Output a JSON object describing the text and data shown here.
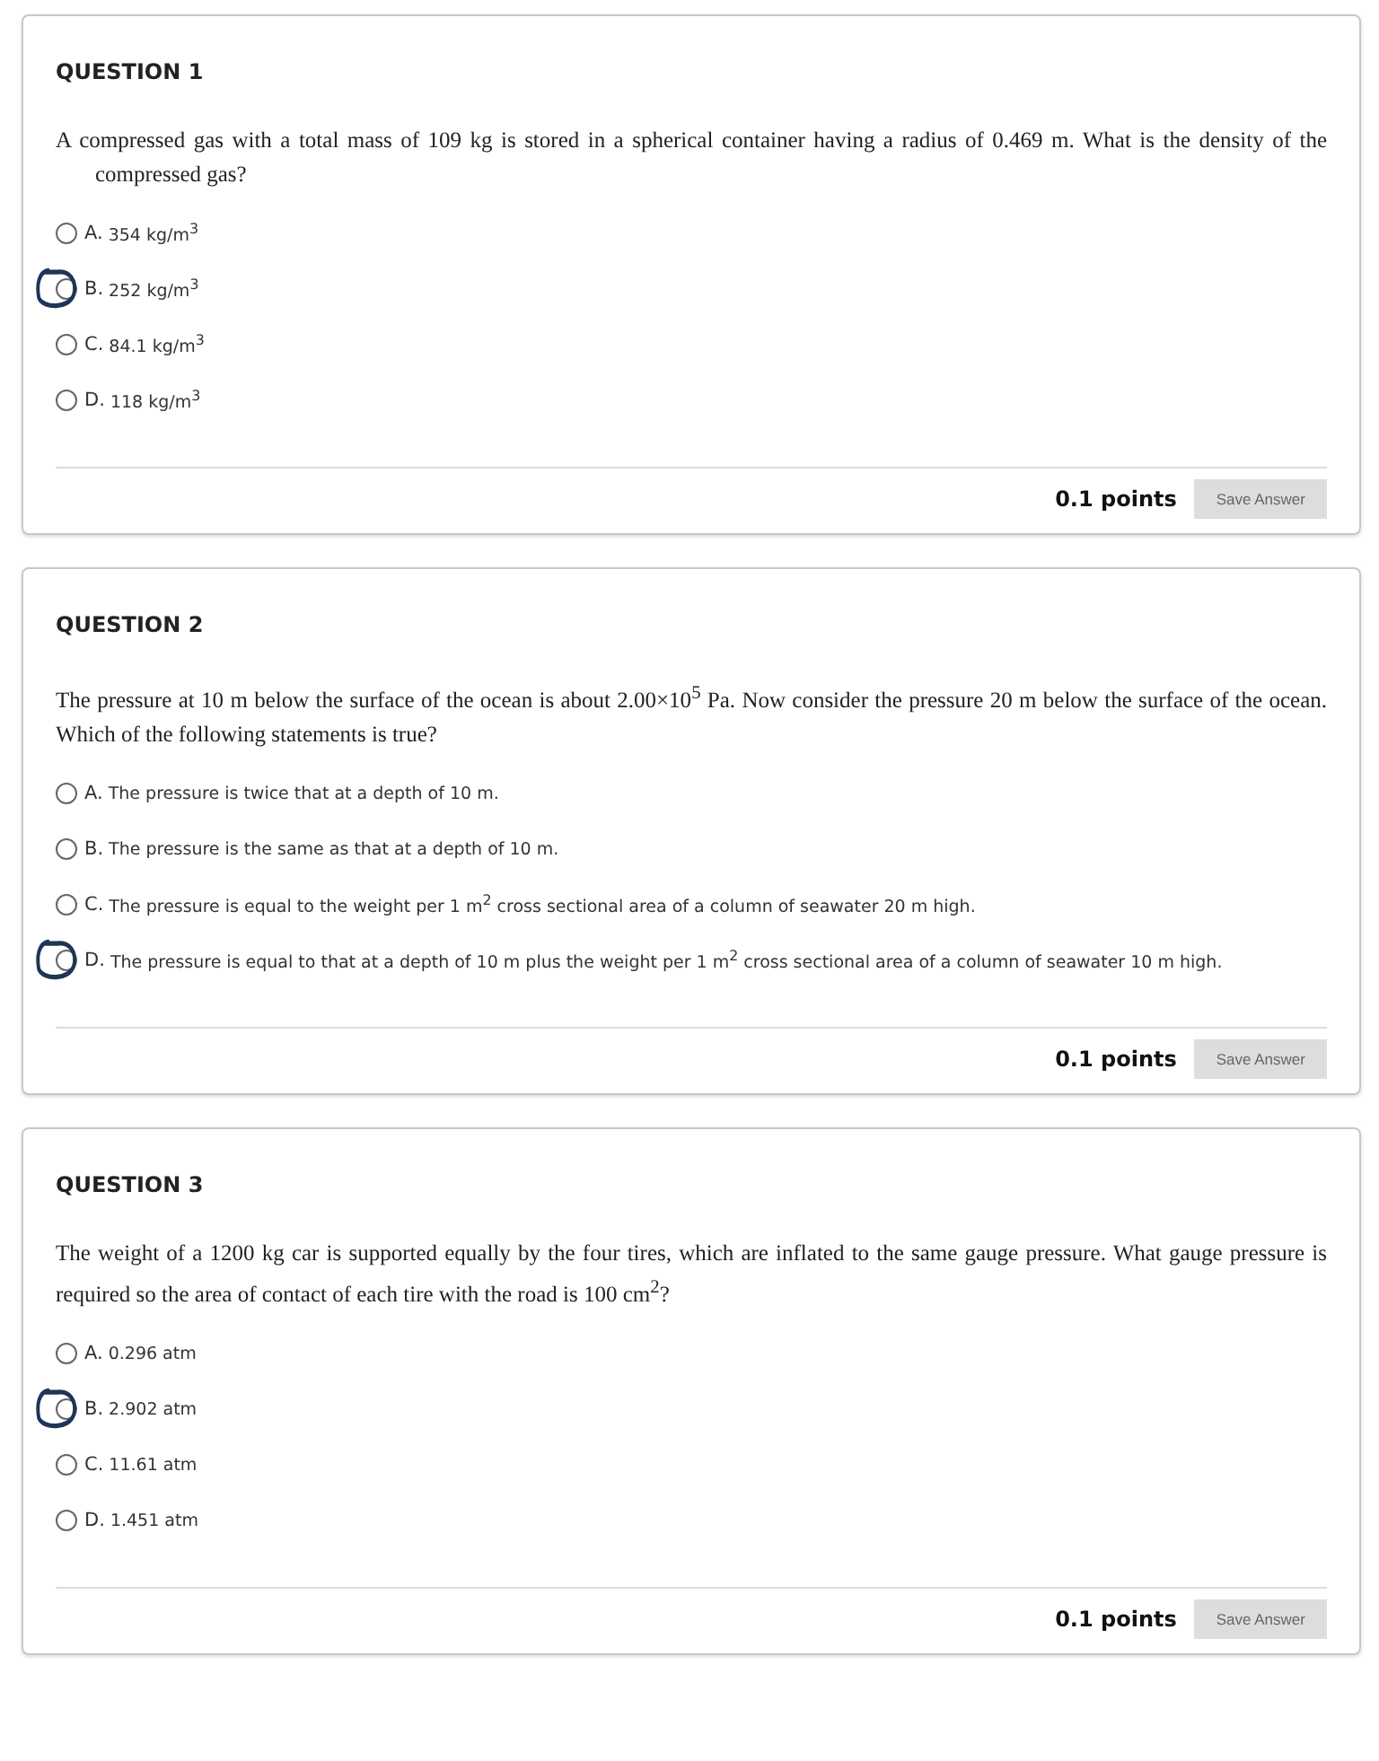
{
  "questions": [
    {
      "title": "QUESTION 1",
      "text": "A compressed gas with a total mass of 109 kg is stored in a spherical container having a radius of 0.469 m. What is the density of the compressed gas?",
      "hanging": true,
      "options": [
        {
          "letter": "A.",
          "text": "354 kg/m$^{3}$",
          "selected": false,
          "marked": false
        },
        {
          "letter": "B.",
          "text": "252 kg/m$^{3}$",
          "selected": false,
          "marked": true
        },
        {
          "letter": "C.",
          "text": "84.1 kg/m$^{3}$",
          "selected": false,
          "marked": false
        },
        {
          "letter": "D.",
          "text": "118 kg/m$^{3}$",
          "selected": false,
          "marked": false
        }
      ],
      "points": "0.1 points",
      "button": "Save Answer"
    },
    {
      "title": "QUESTION 2",
      "text": "The pressure at 10 m below the surface of the ocean is about 2.00×10$^{5}$ Pa. Now consider the pressure 20 m below the surface of the ocean. Which of the following statements is true?",
      "hanging": false,
      "options": [
        {
          "letter": "A.",
          "text": "The pressure is twice that at a depth of 10 m.",
          "selected": false,
          "marked": false
        },
        {
          "letter": "B.",
          "text": "The pressure is the same as that at a depth of 10 m.",
          "selected": false,
          "marked": false
        },
        {
          "letter": "C.",
          "text": "The pressure is equal to the weight per 1 m$^{2}$ cross sectional area of a column of seawater 20 m high.",
          "selected": false,
          "marked": false
        },
        {
          "letter": "D.",
          "text": "The pressure is equal to that at a depth of 10 m plus the weight per 1 m$^{2}$ cross sectional area of a column of seawater 10 m high.",
          "selected": false,
          "marked": true
        }
      ],
      "points": "0.1 points",
      "button": "Save Answer"
    },
    {
      "title": "QUESTION 3",
      "text": "The weight of a 1200 kg car is supported equally by the four tires, which are inflated to the same gauge pressure. What gauge pressure is required so the area of contact of each tire with the road is 100 cm$^{2}$?",
      "hanging": false,
      "options": [
        {
          "letter": "A.",
          "text": "0.296 atm",
          "selected": false,
          "marked": false
        },
        {
          "letter": "B.",
          "text": "2.902 atm",
          "selected": false,
          "marked": true
        },
        {
          "letter": "C.",
          "text": "11.61 atm",
          "selected": false,
          "marked": false
        },
        {
          "letter": "D.",
          "text": "1.451 atm",
          "selected": false,
          "marked": false
        }
      ],
      "points": "0.1 points",
      "button": "Save Answer"
    }
  ]
}
